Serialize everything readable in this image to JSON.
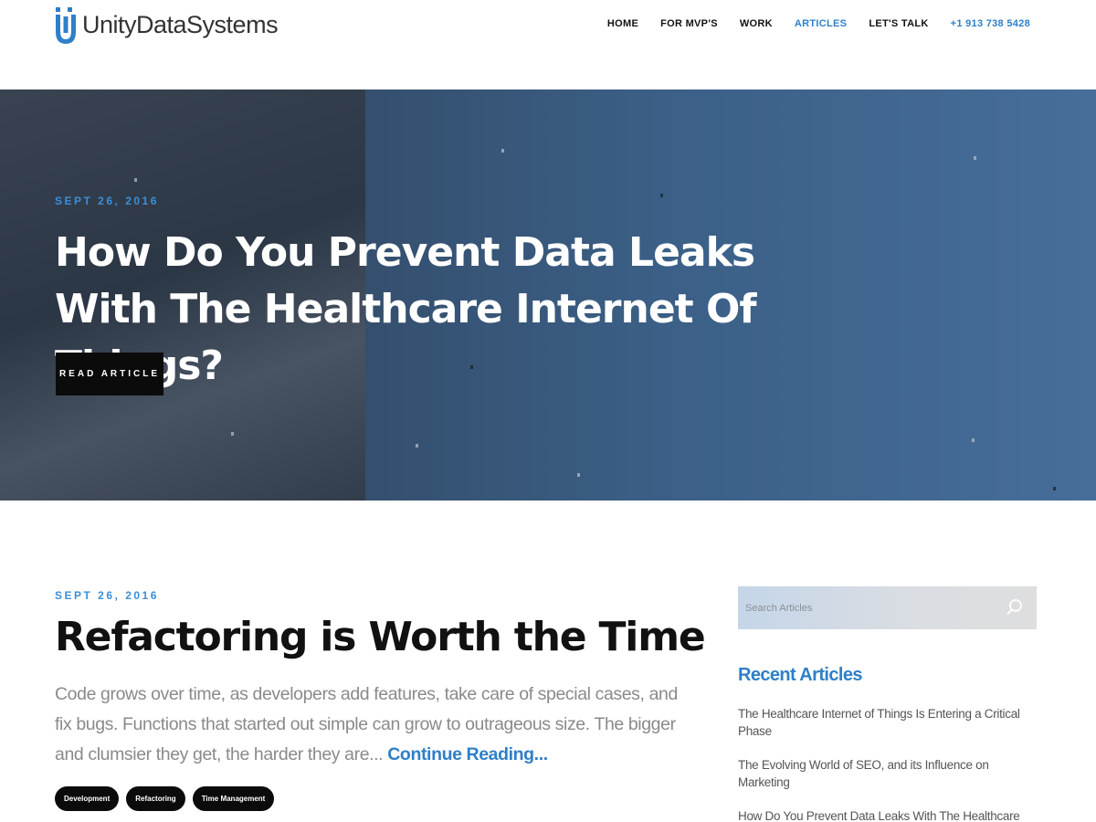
{
  "brand": {
    "name": "UnityDataSystems",
    "accent": "#2e7fc7"
  },
  "nav": {
    "items": [
      {
        "label": "HOME"
      },
      {
        "label": "FOR MVP'S"
      },
      {
        "label": "WORK"
      },
      {
        "label": "ARTICLES",
        "active": true
      },
      {
        "label": "LET'S TALK"
      },
      {
        "label": "+1 913 738 5428"
      }
    ]
  },
  "hero": {
    "date": "SEPT 26, 2016",
    "title": "How Do You Prevent Data Leaks With The Healthcare Internet Of Things?",
    "button": "READ ARTICLE"
  },
  "article": {
    "date": "SEPT 26, 2016",
    "title": "Refactoring is Worth the Time",
    "excerpt": "Code grows over time, as developers add features, take care of special cases, and fix bugs. Functions that started out simple can grow to outrageous size. The bigger and clumsier they get, the harder they are...",
    "continue": "Continue Reading...",
    "tags": [
      "Development",
      "Refactoring",
      "Time Management"
    ]
  },
  "sidebar": {
    "search_placeholder": "Search Articles",
    "recent_title": "Recent Articles",
    "recent": [
      "The Healthcare Internet of Things Is Entering a Critical Phase",
      "The Evolving World of SEO, and its Influence on Marketing",
      "How Do You Prevent Data Leaks With The Healthcare Internet Of Things?"
    ]
  },
  "icons": [
    "logo-u-icon",
    "search-icon"
  ]
}
